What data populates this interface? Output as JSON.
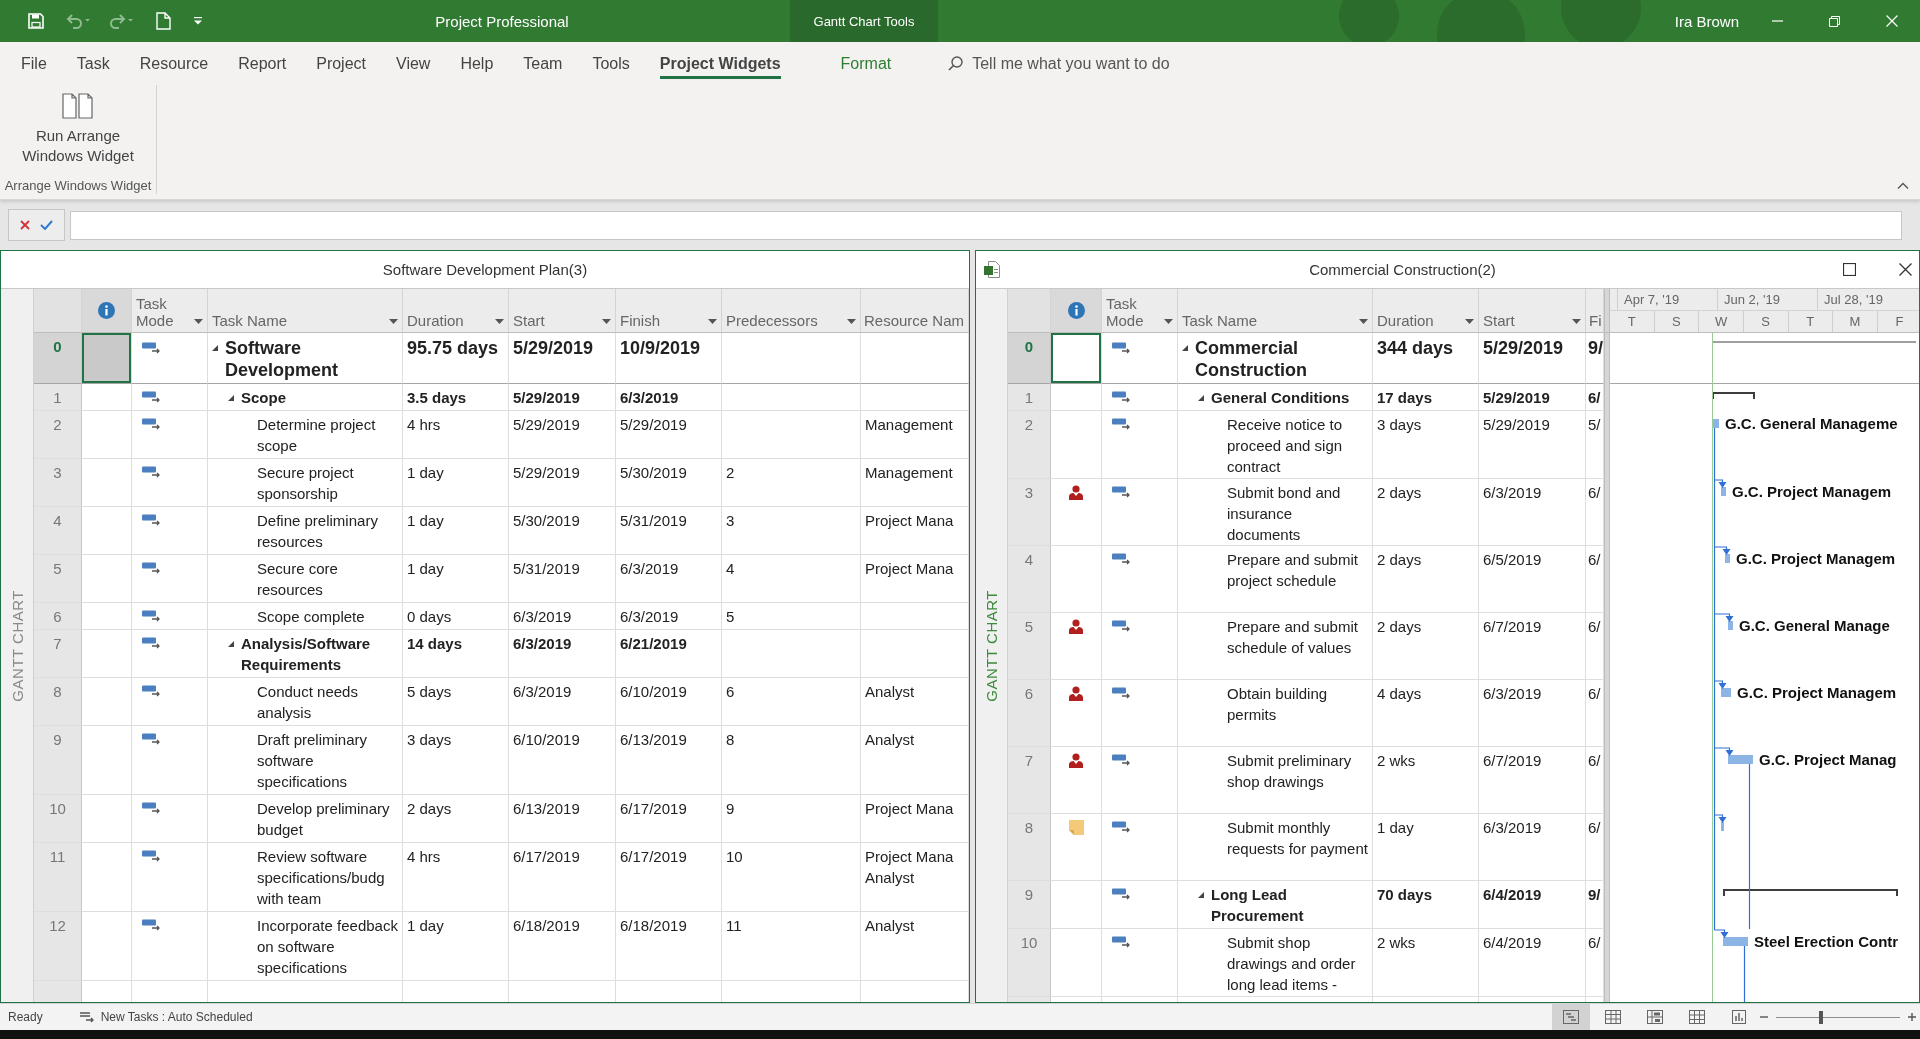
{
  "quick_access": [
    {
      "kind": "save",
      "disabled": false
    },
    {
      "kind": "undo",
      "disabled": true
    },
    {
      "kind": "redo",
      "disabled": true
    },
    {
      "kind": "new",
      "disabled": false
    },
    {
      "kind": "customize",
      "disabled": false
    }
  ],
  "title_bar": {
    "title": "Project Professional",
    "contextual_tab": "Gantt Chart Tools",
    "user": "Ira Brown"
  },
  "ribbon_tabs": [
    {
      "label": "File",
      "kind": "normal",
      "selected": false
    },
    {
      "label": "Task",
      "kind": "normal",
      "selected": false
    },
    {
      "label": "Resource",
      "kind": "normal",
      "selected": false
    },
    {
      "label": "Report",
      "kind": "normal",
      "selected": false
    },
    {
      "label": "Project",
      "kind": "normal",
      "selected": false
    },
    {
      "label": "View",
      "kind": "normal",
      "selected": false
    },
    {
      "label": "Help",
      "kind": "normal",
      "selected": false
    },
    {
      "label": "Team",
      "kind": "normal",
      "selected": false
    },
    {
      "label": "Tools",
      "kind": "normal",
      "selected": false
    },
    {
      "label": "Project Widgets",
      "kind": "normal",
      "selected": true
    },
    {
      "label": "Format",
      "kind": "contextual",
      "selected": false
    }
  ],
  "search": {
    "placeholder": "Tell me what you want to do"
  },
  "ribbon": {
    "groups": [
      {
        "label": "Arrange Windows Widget",
        "buttons": [
          {
            "label": "Run Arrange Windows Widget"
          }
        ]
      }
    ]
  },
  "panes": [
    {
      "title": "Software Development Plan(3)",
      "active": false,
      "view_label": "GANTT CHART",
      "columns": [
        {
          "label": "Task Mode",
          "filter": true
        },
        {
          "label": "Task Name",
          "filter": true
        },
        {
          "label": "Duration",
          "filter": true
        },
        {
          "label": "Start",
          "filter": true
        },
        {
          "label": "Finish",
          "filter": true
        },
        {
          "label": "Predecessors",
          "filter": true
        },
        {
          "label": "Resource Nam",
          "filter": false
        }
      ],
      "rows": [
        {
          "id": "0",
          "name": "Software Development",
          "duration": "95.75 days",
          "start": "5/29/2019",
          "finish": "10/9/2019",
          "selected": true,
          "expanded": true,
          "children": [
            {
              "id": "1",
              "name": "Scope",
              "duration": "3.5 days",
              "start": "5/29/2019",
              "finish": "6/3/2019",
              "selected": false,
              "expanded": true,
              "children": [
                {
                  "id": "2",
                  "name": "Determine project scope",
                  "duration": "4 hrs",
                  "start": "5/29/2019",
                  "finish": "5/29/2019",
                  "resource_names": "Management",
                  "selected": false
                },
                {
                  "id": "3",
                  "name": "Secure project sponsorship",
                  "duration": "1 day",
                  "start": "5/29/2019",
                  "finish": "5/30/2019",
                  "predecessors": "2",
                  "resource_names": "Management",
                  "selected": false
                },
                {
                  "id": "4",
                  "name": "Define preliminary resources",
                  "duration": "1 day",
                  "start": "5/30/2019",
                  "finish": "5/31/2019",
                  "predecessors": "3",
                  "resource_names": "Project Mana",
                  "selected": false
                },
                {
                  "id": "5",
                  "name": "Secure core resources",
                  "duration": "1 day",
                  "start": "5/31/2019",
                  "finish": "6/3/2019",
                  "predecessors": "4",
                  "resource_names": "Project Mana",
                  "selected": false
                },
                {
                  "id": "6",
                  "name": "Scope complete",
                  "duration": "0 days",
                  "start": "6/3/2019",
                  "finish": "6/3/2019",
                  "predecessors": "5",
                  "selected": false
                }
              ]
            },
            {
              "id": "7",
              "name": "Analysis/Software Requirements",
              "duration": "14 days",
              "start": "6/3/2019",
              "finish": "6/21/2019",
              "selected": false,
              "expanded": true,
              "children": [
                {
                  "id": "8",
                  "name": "Conduct needs analysis",
                  "duration": "5 days",
                  "start": "6/3/2019",
                  "finish": "6/10/2019",
                  "predecessors": "6",
                  "resource_names": "Analyst",
                  "selected": false
                },
                {
                  "id": "9",
                  "name": "Draft preliminary software specifications",
                  "duration": "3 days",
                  "start": "6/10/2019",
                  "finish": "6/13/2019",
                  "predecessors": "8",
                  "resource_names": "Analyst",
                  "selected": false
                },
                {
                  "id": "10",
                  "name": "Develop preliminary budget",
                  "duration": "2 days",
                  "start": "6/13/2019",
                  "finish": "6/17/2019",
                  "predecessors": "9",
                  "resource_names": "Project Mana",
                  "selected": false
                },
                {
                  "id": "11",
                  "name": "Review software specifications/budg with team",
                  "duration": "4 hrs",
                  "start": "6/17/2019",
                  "finish": "6/17/2019",
                  "predecessors": "10",
                  "resource_names": "Project Mana\nAnalyst",
                  "selected": false
                },
                {
                  "id": "12",
                  "name": "Incorporate feedback on software specifications",
                  "duration": "1 day",
                  "start": "6/18/2019",
                  "finish": "6/18/2019",
                  "predecessors": "11",
                  "resource_names": "Analyst",
                  "selected": false
                }
              ]
            }
          ]
        }
      ]
    },
    {
      "title": "Commercial Construction(2)",
      "active": true,
      "file_icon": true,
      "window_buttons": [
        {
          "kind": "maximize"
        },
        {
          "kind": "close"
        }
      ],
      "view_label": "GANTT CHART",
      "columns": [
        {
          "label": "Task Mode",
          "filter": true
        },
        {
          "label": "Task Name",
          "filter": true
        },
        {
          "label": "Duration",
          "filter": true
        },
        {
          "label": "Start",
          "filter": true
        },
        {
          "label": "Fi",
          "filter": false
        }
      ],
      "gantt": {
        "top_tier": [
          "Apr 7, '19",
          "Jun 2, '19",
          "Jul 28, '19"
        ],
        "bottom_tier": [
          "T",
          "S",
          "W",
          "S",
          "T",
          "M",
          "F"
        ]
      },
      "rows": [
        {
          "id": "0",
          "name": "Commercial Construction",
          "duration": "344 days",
          "start": "5/29/2019",
          "finish": "9/",
          "selected": true,
          "expanded": true,
          "children": [
            {
              "id": "1",
              "name": "General Conditions",
              "duration": "17 days",
              "start": "5/29/2019",
              "finish": "6/",
              "selected": false,
              "expanded": true,
              "children": [
                {
                  "id": "2",
                  "name": "Receive notice to proceed and sign contract",
                  "duration": "3 days",
                  "start": "5/29/2019",
                  "finish": "5/",
                  "bar_label": "G.C. General Manageme",
                  "selected": false
                },
                {
                  "id": "3",
                  "name": "Submit bond and insurance documents",
                  "duration": "2 days",
                  "start": "6/3/2019",
                  "finish": "6/",
                  "indicators": [
                    {
                      "kind": "resource"
                    }
                  ],
                  "bar_label": "G.C. Project Managem",
                  "selected": false
                },
                {
                  "id": "4",
                  "name": "Prepare and submit project schedule",
                  "duration": "2 days",
                  "start": "6/5/2019",
                  "finish": "6/",
                  "bar_label": "G.C. Project Managem",
                  "selected": false
                },
                {
                  "id": "5",
                  "name": "Prepare and submit schedule of values",
                  "duration": "2 days",
                  "start": "6/7/2019",
                  "finish": "6/",
                  "indicators": [
                    {
                      "kind": "resource"
                    }
                  ],
                  "bar_label": "G.C. General Manage",
                  "selected": false
                },
                {
                  "id": "6",
                  "name": "Obtain building permits",
                  "duration": "4 days",
                  "start": "6/3/2019",
                  "finish": "6/",
                  "indicators": [
                    {
                      "kind": "resource"
                    }
                  ],
                  "bar_label": "G.C. Project Managem",
                  "selected": false
                },
                {
                  "id": "7",
                  "name": "Submit preliminary shop drawings",
                  "duration": "2 wks",
                  "start": "6/7/2019",
                  "finish": "6/",
                  "indicators": [
                    {
                      "kind": "resource"
                    }
                  ],
                  "bar_label": "G.C. Project Manag",
                  "selected": false
                },
                {
                  "id": "8",
                  "name": "Submit monthly requests for payment",
                  "duration": "1 day",
                  "start": "6/3/2019",
                  "finish": "6/",
                  "indicators": [
                    {
                      "kind": "note"
                    }
                  ],
                  "selected": false
                }
              ]
            },
            {
              "id": "9",
              "name": "Long Lead Procurement",
              "duration": "70 days",
              "start": "6/4/2019",
              "finish": "9/",
              "selected": false,
              "expanded": true,
              "children": [
                {
                  "id": "10",
                  "name": "Submit shop drawings and order long lead items -",
                  "duration": "2 wks",
                  "start": "6/4/2019",
                  "finish": "6/",
                  "bar_label": "Steel Erection Contr",
                  "selected": false
                }
              ]
            }
          ]
        }
      ]
    }
  ],
  "status_bar": {
    "status": "Ready",
    "new_tasks": "New Tasks : Auto Scheduled",
    "views": [
      {
        "kind": "gantt",
        "selected": true
      },
      {
        "kind": "task_usage",
        "selected": false
      },
      {
        "kind": "team_planner",
        "selected": false
      },
      {
        "kind": "resource_sheet",
        "selected": false
      },
      {
        "kind": "reports",
        "selected": false
      }
    ],
    "zoom": {
      "level": 0.36
    }
  }
}
